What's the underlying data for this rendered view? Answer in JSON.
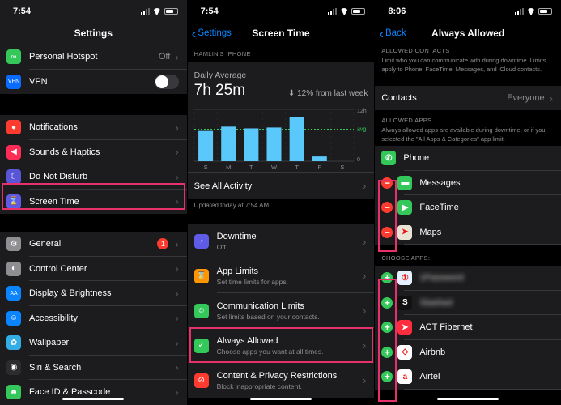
{
  "panel1": {
    "time": "7:54",
    "title": "Settings",
    "group1": [
      {
        "label": "Personal Hotspot",
        "value": "Off",
        "icon": "link-icon",
        "color": "#34c759"
      },
      {
        "label": "VPN",
        "value": "",
        "icon": "vpn-icon",
        "color": "#0a6cff",
        "icon_text": "VPN"
      }
    ],
    "group2": [
      {
        "label": "Notifications",
        "icon": "bell-icon",
        "color": "#ff3b30"
      },
      {
        "label": "Sounds & Haptics",
        "icon": "speaker-icon",
        "color": "#ff2d55"
      },
      {
        "label": "Do Not Disturb",
        "icon": "moon-icon",
        "color": "#5856d6"
      },
      {
        "label": "Screen Time",
        "icon": "hourglass-icon",
        "color": "#5e5ce6"
      }
    ],
    "group3": [
      {
        "label": "General",
        "badge": "1",
        "icon": "gear-icon",
        "color": "#8e8e93"
      },
      {
        "label": "Control Center",
        "icon": "toggles-icon",
        "color": "#8e8e93"
      },
      {
        "label": "Display & Brightness",
        "icon": "text-size-icon",
        "color": "#0a84ff",
        "icon_text": "AA"
      },
      {
        "label": "Accessibility",
        "icon": "accessibility-icon",
        "color": "#0a84ff"
      },
      {
        "label": "Wallpaper",
        "icon": "flower-icon",
        "color": "#32ade6"
      },
      {
        "label": "Siri & Search",
        "icon": "siri-icon",
        "color": "#2c2c2e"
      },
      {
        "label": "Face ID & Passcode",
        "icon": "face-id-icon",
        "color": "#34c759"
      }
    ]
  },
  "panel2": {
    "time": "7:54",
    "back": "Settings",
    "title": "Screen Time",
    "device": "HAMLIN'S IPHONE",
    "daily_label": "Daily Average",
    "daily_value": "7h 25m",
    "change": "12% from last week",
    "see_all": "See All Activity",
    "updated": "Updated today at 7:54 AM",
    "items": [
      {
        "title": "Downtime",
        "sub": "Off",
        "icon": "downtime-icon",
        "color": "#5e5ce6"
      },
      {
        "title": "App Limits",
        "sub": "Set time limits for apps.",
        "icon": "hourglass-icon",
        "color": "#ff9500"
      },
      {
        "title": "Communication Limits",
        "sub": "Set limits based on your contacts.",
        "icon": "person-icon",
        "color": "#34c759"
      },
      {
        "title": "Always Allowed",
        "sub": "Choose apps you want at all times.",
        "icon": "check-icon",
        "color": "#34c759"
      },
      {
        "title": "Content & Privacy Restrictions",
        "sub": "Block inappropriate content.",
        "icon": "block-icon",
        "color": "#ff3b30"
      }
    ]
  },
  "chart_data": {
    "type": "bar",
    "categories": [
      "S",
      "M",
      "T",
      "W",
      "T",
      "F",
      "S"
    ],
    "values": [
      7.0,
      8.0,
      7.6,
      7.8,
      10.2,
      1.1,
      0
    ],
    "ylim": [
      0,
      12
    ],
    "y_ticks": [
      "12h",
      "avg",
      "0"
    ],
    "average": 7.4,
    "bar_color": "#5ac8fa"
  },
  "panel3": {
    "time": "8:06",
    "back": "Back",
    "title": "Always Allowed",
    "contacts_header": "ALLOWED CONTACTS",
    "contacts_desc": "Limit who you can communicate with during downtime. Limits apply to Phone, FaceTime, Messages, and iCloud contacts.",
    "contacts_label": "Contacts",
    "contacts_value": "Everyone",
    "apps_header": "ALLOWED APPS",
    "apps_desc": "Always allowed apps are available during downtime, or if you selected the \"All Apps & Categories\" app limit.",
    "allowed": [
      {
        "label": "Phone",
        "icon": "phone-icon",
        "color": "#34c759",
        "removable": false
      },
      {
        "label": "Messages",
        "icon": "messages-icon",
        "color": "#34c759",
        "removable": true
      },
      {
        "label": "FaceTime",
        "icon": "facetime-icon",
        "color": "#34c759",
        "removable": true
      },
      {
        "label": "Maps",
        "icon": "maps-icon",
        "color": "#e8e3d4",
        "removable": true
      }
    ],
    "choose_header": "CHOOSE APPS:",
    "choose": [
      {
        "label": "1Password",
        "icon": "1password-icon",
        "color": "#e5f0ff",
        "blurred": true
      },
      {
        "label": "Stashed",
        "icon": "s-app-icon",
        "color": "#111",
        "blurred": true
      },
      {
        "label": "ACT Fibernet",
        "icon": "act-icon",
        "color": "#ff2d3d",
        "blurred": false
      },
      {
        "label": "Airbnb",
        "icon": "airbnb-icon",
        "color": "#ffffff",
        "blurred": false
      },
      {
        "label": "Airtel",
        "icon": "airtel-icon",
        "color": "#ffffff",
        "blurred": false
      }
    ]
  }
}
